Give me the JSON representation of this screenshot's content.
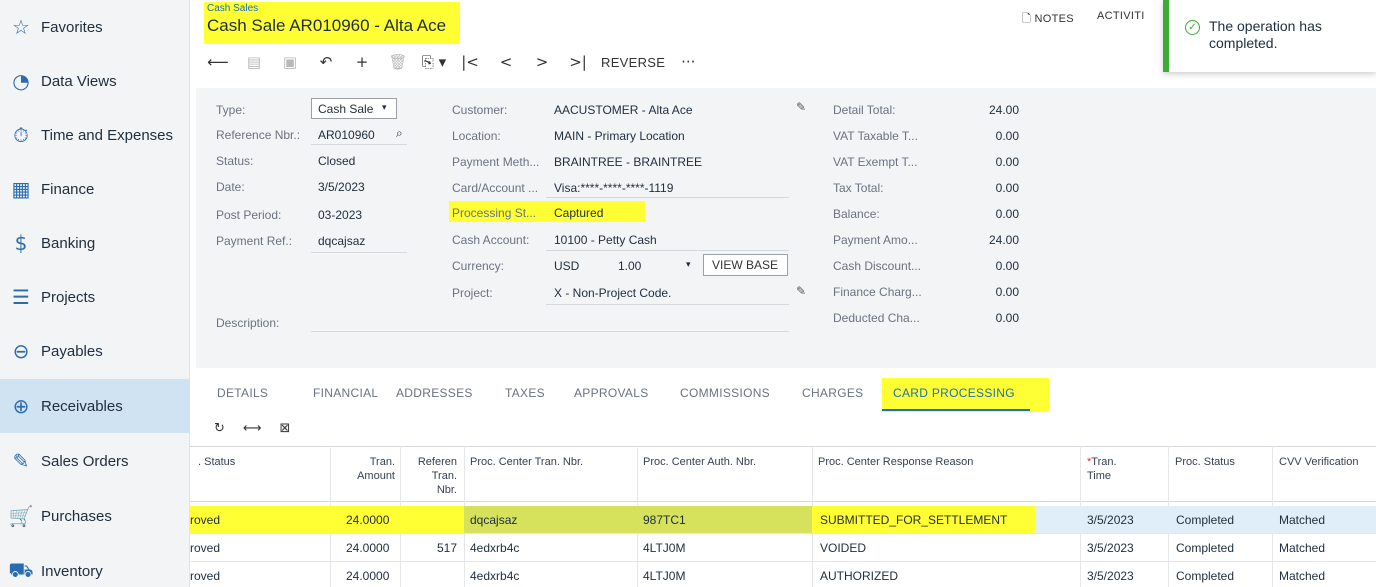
{
  "sidebar": {
    "items": [
      {
        "label": "Favorites",
        "icon": "star-icon",
        "glyph": "☆"
      },
      {
        "label": "Data Views",
        "icon": "pie-chart-icon",
        "glyph": "◔"
      },
      {
        "label": "Time and Expenses",
        "icon": "stopwatch-icon",
        "glyph": "⏱"
      },
      {
        "label": "Finance",
        "icon": "calculator-icon",
        "glyph": "▦"
      },
      {
        "label": "Banking",
        "icon": "dollar-icon",
        "glyph": "$"
      },
      {
        "label": "Projects",
        "icon": "projects-icon",
        "glyph": "☰"
      },
      {
        "label": "Payables",
        "icon": "minus-circle-icon",
        "glyph": "⊖"
      },
      {
        "label": "Receivables",
        "icon": "plus-circle-icon",
        "glyph": "⊕"
      },
      {
        "label": "Sales Orders",
        "icon": "pencil-icon",
        "glyph": "✎"
      },
      {
        "label": "Purchases",
        "icon": "cart-icon",
        "glyph": "🛒"
      },
      {
        "label": "Inventory",
        "icon": "truck-icon",
        "glyph": "⛟"
      }
    ],
    "active": "Receivables"
  },
  "header": {
    "breadcrumb": "Cash Sales",
    "title": "Cash Sale AR010960 - Alta Ace",
    "notes": "NOTES",
    "activities": "ACTIVITI",
    "toolbar": {
      "reverse": "REVERSE",
      "more": "···"
    }
  },
  "toast": {
    "message": "The operation has completed."
  },
  "form": {
    "col1": {
      "type_label": "Type:",
      "type_value": "Cash Sale",
      "ref_label": "Reference Nbr.:",
      "ref_value": "AR010960",
      "status_label": "Status:",
      "status_value": "Closed",
      "date_label": "Date:",
      "date_value": "3/5/2023",
      "period_label": "Post Period:",
      "period_value": "03-2023",
      "payref_label": "Payment Ref.:",
      "payref_value": "dqcajsaz",
      "desc_label": "Description:"
    },
    "col2": {
      "customer_label": "Customer:",
      "customer_value": "AACUSTOMER - Alta Ace",
      "location_label": "Location:",
      "location_value": "MAIN - Primary Location",
      "paymeth_label": "Payment Meth...",
      "paymeth_value": "BRAINTREE - BRAINTREE",
      "card_label": "Card/Account ...",
      "card_value": "Visa:****-****-****-1119",
      "procst_label": "Processing St...",
      "procst_value": "Captured",
      "cash_label": "Cash Account:",
      "cash_value": "10100 - Petty Cash",
      "currency_label": "Currency:",
      "currency_value": "USD",
      "rate_value": "1.00",
      "viewbase": "VIEW BASE",
      "project_label": "Project:",
      "project_value": "X - Non-Project Code."
    },
    "col3": [
      {
        "label": "Detail Total:",
        "value": "24.00"
      },
      {
        "label": "VAT Taxable T...",
        "value": "0.00"
      },
      {
        "label": "VAT Exempt T...",
        "value": "0.00"
      },
      {
        "label": "Tax Total:",
        "value": "0.00"
      },
      {
        "label": "Balance:",
        "value": "0.00"
      },
      {
        "label": "Payment Amo...",
        "value": "24.00"
      },
      {
        "label": "Cash Discount...",
        "value": "0.00"
      },
      {
        "label": "Finance Charg...",
        "value": "0.00"
      },
      {
        "label": "Deducted Cha...",
        "value": "0.00"
      }
    ]
  },
  "tabs": [
    "DETAILS",
    "FINANCIAL",
    "ADDRESSES",
    "TAXES",
    "APPROVALS",
    "COMMISSIONS",
    "CHARGES",
    "CARD PROCESSING"
  ],
  "active_tab": "CARD PROCESSING",
  "table": {
    "headers": {
      "status": ". Status",
      "tran_amount_1": "Tran.",
      "tran_amount_2": "Amount",
      "ref_1": "Referen",
      "ref_2": "Tran.",
      "ref_3": "Nbr.",
      "pc_tran": "Proc. Center Tran. Nbr.",
      "pc_auth": "Proc. Center Auth. Nbr.",
      "pc_reason": "Proc. Center Response Reason",
      "tran_time_star": "*",
      "tran_time_1": "Tran.",
      "tran_time_2": "Time",
      "proc_status": "Proc. Status",
      "cvv": "CVV Verification"
    },
    "rows": [
      {
        "status": "roved",
        "amount": "24.0000",
        "ref": "",
        "pc_tran": "dqcajsaz",
        "pc_auth": "987TC1",
        "reason": "SUBMITTED_FOR_SETTLEMENT",
        "time": "3/5/2023",
        "proc_status": "Completed",
        "cvv": "Matched"
      },
      {
        "status": "roved",
        "amount": "24.0000",
        "ref": "517",
        "pc_tran": "4edxrb4c",
        "pc_auth": "4LTJ0M",
        "reason": "VOIDED",
        "time": "3/5/2023",
        "proc_status": "Completed",
        "cvv": "Matched"
      },
      {
        "status": "roved",
        "amount": "24.0000",
        "ref": "",
        "pc_tran": "4edxrb4c",
        "pc_auth": "4LTJ0M",
        "reason": "AUTHORIZED",
        "time": "3/5/2023",
        "proc_status": "Completed",
        "cvv": "Matched"
      }
    ]
  },
  "colors": {
    "highlight": "#ffff33",
    "accent": "#1f6fb5",
    "success": "#3cab37",
    "active_nav": "#cfe3f3"
  }
}
